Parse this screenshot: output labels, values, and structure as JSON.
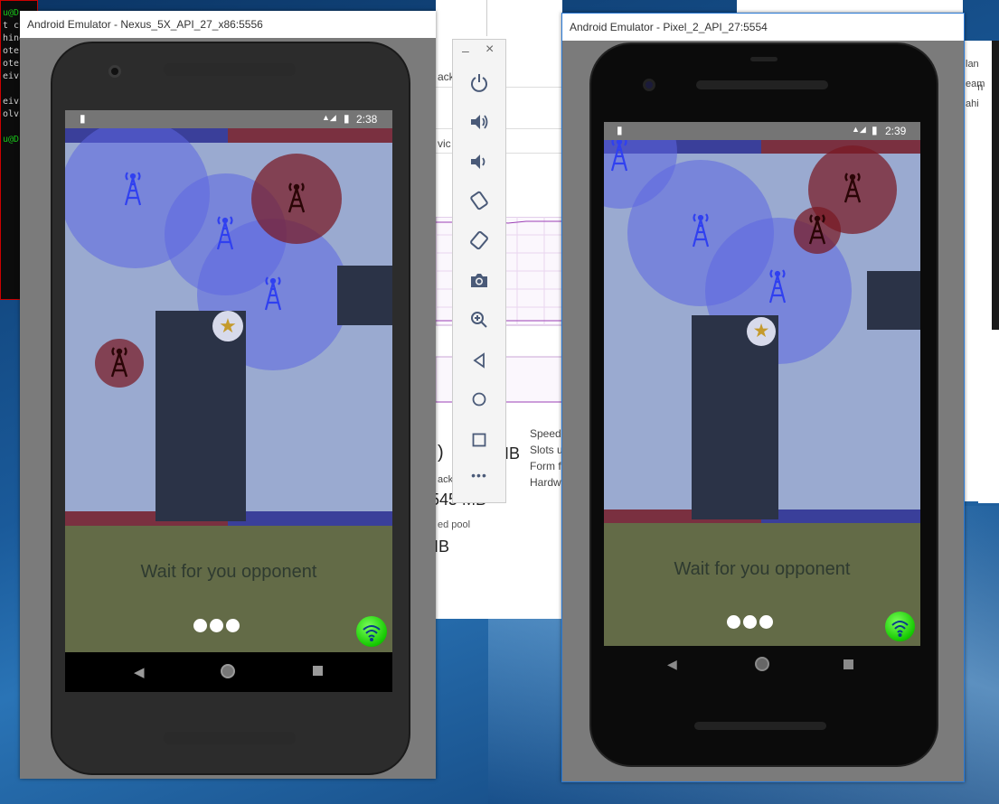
{
  "terminal": {
    "lines": [
      "u@D",
      "t c",
      "hing",
      "ote:",
      "ote:",
      "eivi",
      "",
      "eivi",
      "olvi",
      "",
      "u@D"
    ]
  },
  "background_app": {
    "partial_labels": [
      "ack",
      "vic",
      "ack"
    ],
    "speed_label": "Speed:",
    "slots_label": "Slots u",
    "form_label": "Form f",
    "hardware_label": "Hardw",
    "paren": ")",
    "mb_big": "545 MB",
    "mb_right": "IB",
    "pool_label": "ed pool",
    "mb_small": "IB"
  },
  "right_bg_window": {
    "lines": [
      "lan",
      "eam",
      "ahi"
    ]
  },
  "emulator_left": {
    "title": "Android Emulator - Nexus_5X_API_27_x86:5556",
    "status_time": "2:38",
    "wait_text": "Wait for you opponent"
  },
  "emulator_right": {
    "title": "Android Emulator - Pixel_2_API_27:5554",
    "status_time": "2:39",
    "wait_text": "Wait for you opponent"
  },
  "toolbar": {
    "minimize": "–",
    "close": "×",
    "buttons": [
      {
        "name": "power-icon",
        "glyph": "⏻"
      },
      {
        "name": "volume-up-icon",
        "glyph": "🔊"
      },
      {
        "name": "volume-down-icon",
        "glyph": "🔉"
      },
      {
        "name": "rotate-left-icon",
        "glyph": "⟲"
      },
      {
        "name": "rotate-right-icon",
        "glyph": "⟳"
      },
      {
        "name": "camera-icon",
        "glyph": "📷"
      },
      {
        "name": "zoom-icon",
        "glyph": "🔍"
      },
      {
        "name": "back-icon",
        "glyph": "◁"
      },
      {
        "name": "home-icon",
        "glyph": "○"
      },
      {
        "name": "overview-icon",
        "glyph": "□"
      },
      {
        "name": "more-icon",
        "glyph": "•••"
      }
    ]
  },
  "colors": {
    "game_bg": "#9aaad0",
    "team_blue": "#3a3f9a",
    "team_red": "#7a3040",
    "bottom_panel": "#636b47",
    "wifi_green": "#14c800"
  }
}
